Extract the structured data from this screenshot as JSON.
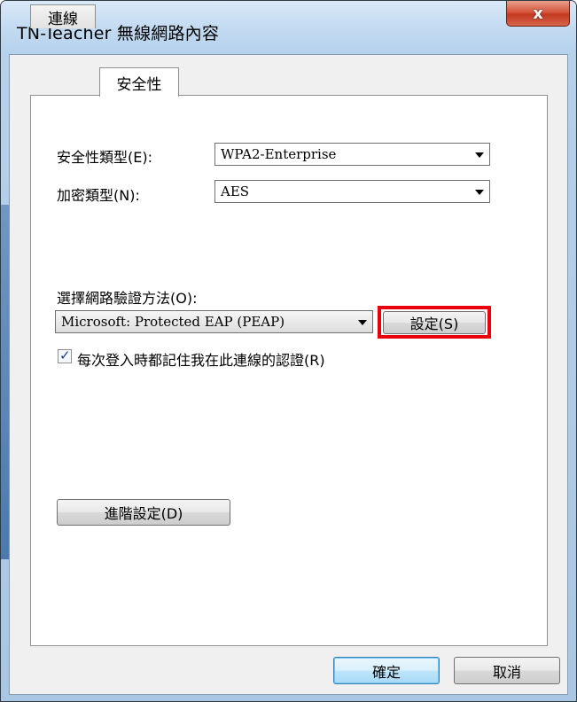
{
  "window": {
    "title": "TN-Teacher 無線網路內容",
    "close_label": "x"
  },
  "tabs": [
    {
      "label": "連線"
    },
    {
      "label": "安全性"
    }
  ],
  "security": {
    "type_label": "安全性類型(E):",
    "type_value": "WPA2-Enterprise",
    "encryption_label": "加密類型(N):",
    "encryption_value": "AES",
    "auth_method_label": "選擇網路驗證方法(O):",
    "auth_method_value": "Microsoft: Protected EAP (PEAP)",
    "settings_button": "設定(S)",
    "remember_label": "每次登入時都記住我在此連線的認證(R)",
    "remember_checked": true,
    "advanced_button": "進階設定(D)"
  },
  "footer": {
    "ok_label": "確定",
    "cancel_label": "取消"
  },
  "colors": {
    "highlight": "#e8000b",
    "close": "#c23a20",
    "title_bar": "#c3dbf1"
  }
}
